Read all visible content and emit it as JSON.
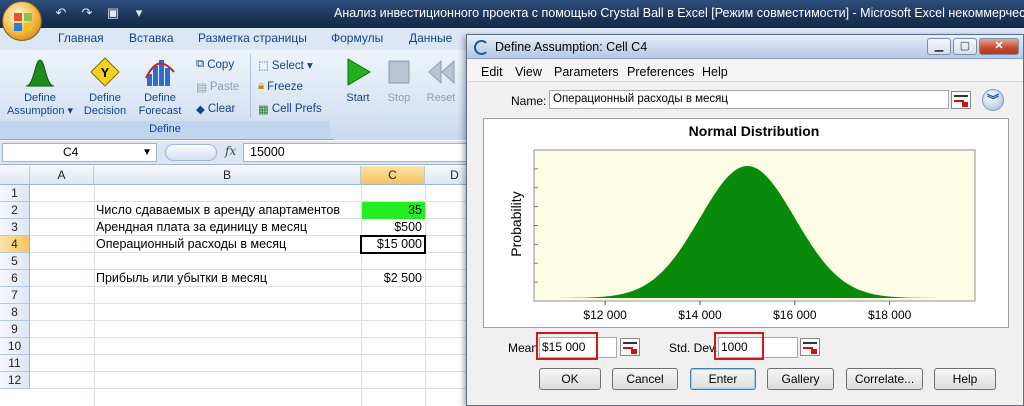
{
  "window": {
    "title": "Анализ инвестиционного проекта с помощью Crystal Ball в Excel  [Режим совместимости] - Microsoft Excel некоммерческое"
  },
  "ribbon": {
    "tabs": [
      "Главная",
      "Вставка",
      "Разметка страницы",
      "Формулы",
      "Данные"
    ],
    "buttons": {
      "define_assumption": [
        "Define",
        "Assumption ▾"
      ],
      "define_decision": [
        "Define",
        "Decision"
      ],
      "define_forecast": [
        "Define",
        "Forecast"
      ],
      "copy": "Copy",
      "paste": "Paste",
      "clear": "Clear",
      "select": "Select ▾",
      "freeze": "Freeze",
      "cell_prefs": "Cell Prefs",
      "start": "Start",
      "stop": "Stop",
      "reset": "Reset"
    },
    "group_label": "Define"
  },
  "formula_bar": {
    "name_box": "C4",
    "fx": "fx",
    "value": "15000"
  },
  "sheet": {
    "columns": [
      "A",
      "B",
      "C",
      "D"
    ],
    "rows": [
      "1",
      "2",
      "3",
      "4",
      "5",
      "6",
      "7",
      "8",
      "9",
      "10",
      "11",
      "12"
    ],
    "cells": {
      "B2": "Число сдаваемых в аренду апартаментов",
      "C2": "35",
      "B3": "Арендная плата за единицу в месяц",
      "C3": "$500",
      "B4": "Операционный расходы в месяц",
      "C4": "$15 000",
      "B6": "Прибыль или убытки в месяц",
      "C6": "$2 500"
    },
    "selected_cell": "C4"
  },
  "dialog": {
    "title": "Define Assumption: Cell C4",
    "menu": [
      "Edit",
      "View",
      "Parameters",
      "Preferences",
      "Help"
    ],
    "name_label": "Name:",
    "name_value": "Операционный расходы в месяц",
    "mean_label": "Mean",
    "mean_value": "$15 000",
    "stddev_label": "Std. Dev.",
    "stddev_value": "1000",
    "buttons": [
      "OK",
      "Cancel",
      "Enter",
      "Gallery",
      "Correlate...",
      "Help"
    ]
  },
  "chart_data": {
    "type": "area",
    "title": "Normal Distribution",
    "ylabel": "Probability",
    "xlabel": "",
    "x_ticks": [
      "$12 000",
      "$14 000",
      "$16 000",
      "$18 000"
    ],
    "tick_values": [
      12000,
      14000,
      16000,
      18000
    ],
    "xlim": [
      10500,
      19800
    ],
    "distribution": {
      "mean": 15000,
      "std_dev": 1000
    },
    "fill_color": "#0a8a0a",
    "plot_background": "#fdfde6"
  },
  "colors": {
    "green_cell": "#22ee22",
    "selected_header": "#f7c45e",
    "highlight_box": "#d01818"
  }
}
